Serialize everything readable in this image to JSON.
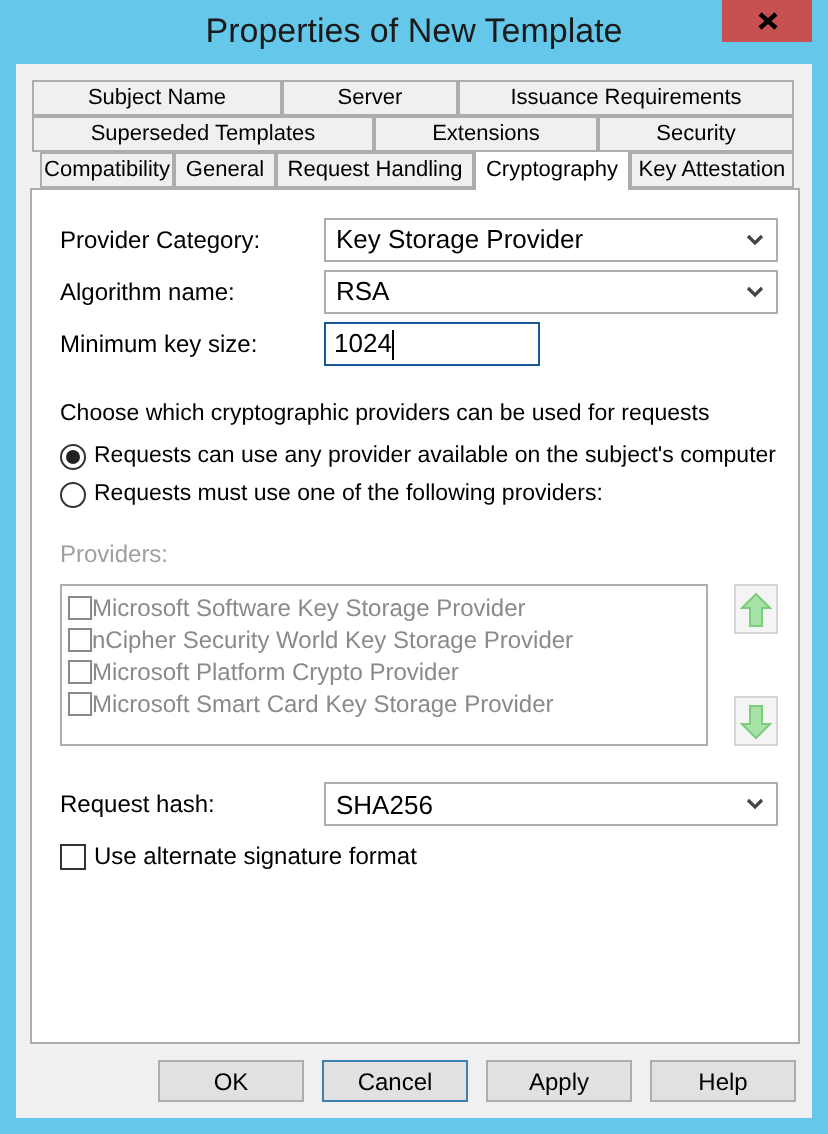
{
  "window": {
    "title": "Properties of New Template"
  },
  "tab_rows": [
    [
      {
        "label": "Subject Name",
        "selected": false
      },
      {
        "label": "Server",
        "selected": false
      },
      {
        "label": "Issuance Requirements",
        "selected": false
      }
    ],
    [
      {
        "label": "Superseded Templates",
        "selected": false
      },
      {
        "label": "Extensions",
        "selected": false
      },
      {
        "label": "Security",
        "selected": false
      }
    ],
    [
      {
        "label": "Compatibility",
        "selected": false
      },
      {
        "label": "General",
        "selected": false
      },
      {
        "label": "Request Handling",
        "selected": false
      },
      {
        "label": "Cryptography",
        "selected": true
      },
      {
        "label": "Key Attestation",
        "selected": false
      }
    ]
  ],
  "fields": [
    {
      "kind": "select",
      "label": "Provider Category:",
      "value": "Key Storage Provider"
    },
    {
      "kind": "select",
      "label": "Algorithm name:",
      "value": "RSA"
    },
    {
      "kind": "text",
      "label": "Minimum key size:",
      "value": "1024"
    }
  ],
  "providers_prompt": "Choose which cryptographic providers can be used for requests",
  "radios": [
    {
      "label": "Requests can use any provider available on the subject's computer",
      "selected": true
    },
    {
      "label": "Requests must use one of the following providers:",
      "selected": false
    }
  ],
  "providers": {
    "label": "Providers:",
    "disabled": true,
    "items": [
      {
        "label": "Microsoft Software Key Storage Provider",
        "checked": false
      },
      {
        "label": "nCipher Security World Key Storage Provider",
        "checked": false
      },
      {
        "label": "Microsoft Platform Crypto Provider",
        "checked": false
      },
      {
        "label": "Microsoft Smart Card Key Storage Provider",
        "checked": false
      }
    ]
  },
  "request_hash": {
    "label": "Request hash:",
    "value": "SHA256"
  },
  "alternate_signature": {
    "label": "Use alternate signature format",
    "checked": false
  },
  "buttons": [
    {
      "label": "OK",
      "focused": false
    },
    {
      "label": "Cancel",
      "focused": true
    },
    {
      "label": "Apply",
      "focused": false
    },
    {
      "label": "Help",
      "focused": false
    }
  ]
}
